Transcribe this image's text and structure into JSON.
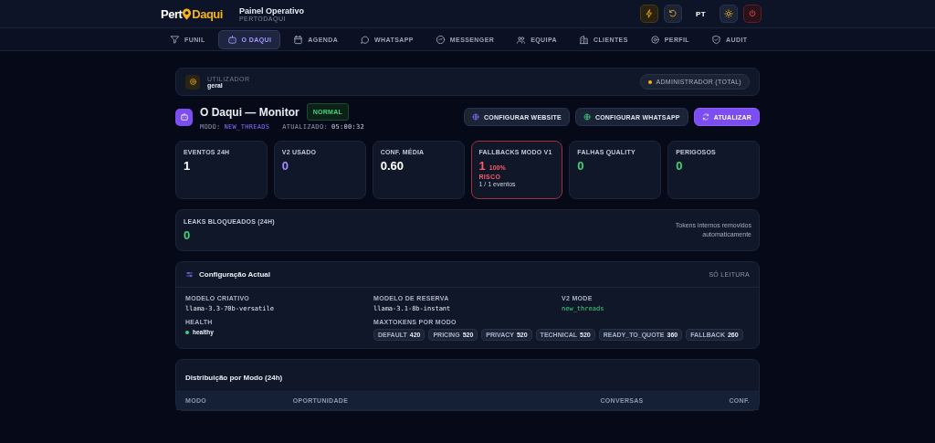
{
  "brand": {
    "part1": "Pert",
    "part2": "Daqui",
    "title": "Painel Operativo",
    "subtitle": "PERTODAQUI"
  },
  "header_actions": [
    {
      "kind": "bolt"
    },
    {
      "kind": "undo"
    },
    {
      "kind": "lang",
      "label": "PT"
    },
    {
      "kind": "sun"
    },
    {
      "kind": "power"
    }
  ],
  "tabs": [
    {
      "label": "FUNIL",
      "kind": "filter",
      "selected": false
    },
    {
      "label": "O DAQUI",
      "kind": "robot",
      "selected": true
    },
    {
      "label": "AGENDA",
      "kind": "calendar",
      "selected": false
    },
    {
      "label": "WHATSAPP",
      "kind": "chat",
      "selected": false
    },
    {
      "label": "MESSENGER",
      "kind": "messenger",
      "selected": false
    },
    {
      "label": "EQUIPA",
      "kind": "users",
      "selected": false
    },
    {
      "label": "CLIENTES",
      "kind": "building",
      "selected": false
    },
    {
      "label": "PERFIL",
      "kind": "gear",
      "selected": false
    },
    {
      "label": "AUDIT",
      "kind": "shield",
      "selected": false
    }
  ],
  "user": {
    "label": "UTILIZADOR",
    "name": "geral",
    "role": "ADMINISTRADOR (TOTAL)"
  },
  "monitor": {
    "title": "O Daqui — Monitor",
    "status": "NORMAL",
    "mode_label": "MODO:",
    "mode": "NEW_THREADS",
    "updated_label": "ATUALIZADO:",
    "updated": "05:00:32",
    "buttons": [
      {
        "kind": "website",
        "label": "CONFIGURAR WEBSITE"
      },
      {
        "kind": "whatsapp",
        "label": "CONFIGURAR WHATSAPP"
      },
      {
        "kind": "primary",
        "label": "ATUALIZAR"
      }
    ]
  },
  "stats": [
    {
      "label": "EVENTOS 24H",
      "value": "1",
      "color": "#ffffff",
      "alert": false
    },
    {
      "label": "V2 USADO",
      "value": "0",
      "color": "#a88bff",
      "alert": false
    },
    {
      "label": "CONF. MÉDIA",
      "value": "0.60",
      "color": "#ffffff",
      "alert": false
    },
    {
      "label": "FALLBACKS MODO V1",
      "value": "1",
      "color": "#ff5a66",
      "alert": true,
      "percent": "100%",
      "flag": "RISCO",
      "detail": "1 / 1 eventos"
    },
    {
      "label": "FALHAS QUALITY",
      "value": "0",
      "color": "#3fd47a",
      "alert": false
    },
    {
      "label": "PERIGOSOS",
      "value": "0",
      "color": "#3fd47a",
      "alert": false
    }
  ],
  "leaks": {
    "label": "LEAKS BLOQUEADOS (24H)",
    "value": "0",
    "note": "Tokens internos removidos automaticamente"
  },
  "config": {
    "title": "Configuração Actual",
    "badge": "SÓ LEITURA",
    "fields": [
      {
        "label": "MODELO CRIATIVO",
        "value": "llama-3.3-70b-versatile",
        "kind": "code"
      },
      {
        "label": "MODELO DE RESERVA",
        "value": "llama-3.1-8b-instant",
        "kind": "code"
      },
      {
        "label": "V2 MODE",
        "value": "new_threads",
        "kind": "code-green"
      },
      {
        "label": "HEALTH",
        "value": "healthy",
        "kind": "status"
      }
    ],
    "tokens_label": "MAXTOKENS POR MODO",
    "tokens": [
      {
        "name": "DEFAULT",
        "value": "420"
      },
      {
        "name": "PRICING",
        "value": "520"
      },
      {
        "name": "PRIVACY",
        "value": "520"
      },
      {
        "name": "TECHNICAL",
        "value": "520"
      },
      {
        "name": "READY_TO_QUOTE",
        "value": "360"
      },
      {
        "name": "FALLBACK",
        "value": "260"
      }
    ]
  },
  "distribution": {
    "title": "Distribuição por Modo (24h)",
    "columns": [
      "MODO",
      "OPORTUNIDADE",
      "CONVERSAS",
      "CONF."
    ]
  }
}
